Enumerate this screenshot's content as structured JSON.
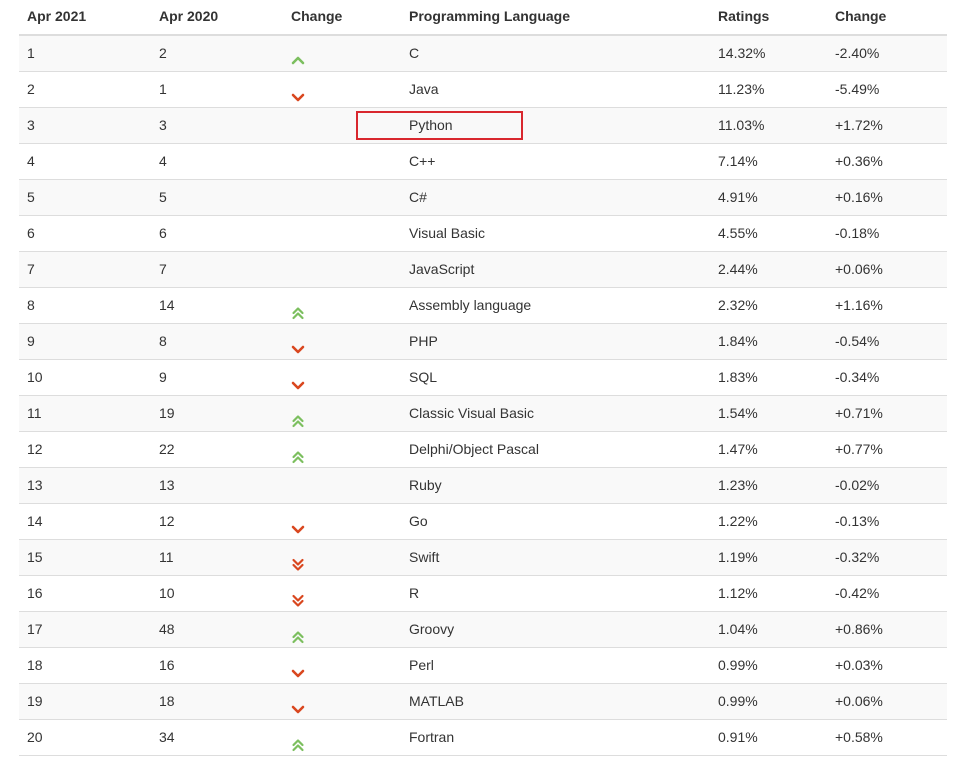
{
  "columns": {
    "rank": "Apr 2021",
    "previous": "Apr 2020",
    "trend": "Change",
    "language": "Programming Language",
    "rating": "Ratings",
    "change": "Change"
  },
  "colors": {
    "up": "#7cbf5f",
    "down": "#d9471f",
    "highlight": "#d9272e"
  },
  "highlighted_language": "Python",
  "rows": [
    {
      "rank": "1",
      "previous": "2",
      "trend": "up",
      "language": "C",
      "rating": "14.32%",
      "change": "-2.40%"
    },
    {
      "rank": "2",
      "previous": "1",
      "trend": "down",
      "language": "Java",
      "rating": "11.23%",
      "change": "-5.49%"
    },
    {
      "rank": "3",
      "previous": "3",
      "trend": "none",
      "language": "Python",
      "rating": "11.03%",
      "change": "+1.72%"
    },
    {
      "rank": "4",
      "previous": "4",
      "trend": "none",
      "language": "C++",
      "rating": "7.14%",
      "change": "+0.36%"
    },
    {
      "rank": "5",
      "previous": "5",
      "trend": "none",
      "language": "C#",
      "rating": "4.91%",
      "change": "+0.16%"
    },
    {
      "rank": "6",
      "previous": "6",
      "trend": "none",
      "language": "Visual Basic",
      "rating": "4.55%",
      "change": "-0.18%"
    },
    {
      "rank": "7",
      "previous": "7",
      "trend": "none",
      "language": "JavaScript",
      "rating": "2.44%",
      "change": "+0.06%"
    },
    {
      "rank": "8",
      "previous": "14",
      "trend": "up-double",
      "language": "Assembly language",
      "rating": "2.32%",
      "change": "+1.16%"
    },
    {
      "rank": "9",
      "previous": "8",
      "trend": "down",
      "language": "PHP",
      "rating": "1.84%",
      "change": "-0.54%"
    },
    {
      "rank": "10",
      "previous": "9",
      "trend": "down",
      "language": "SQL",
      "rating": "1.83%",
      "change": "-0.34%"
    },
    {
      "rank": "11",
      "previous": "19",
      "trend": "up-double",
      "language": "Classic Visual Basic",
      "rating": "1.54%",
      "change": "+0.71%"
    },
    {
      "rank": "12",
      "previous": "22",
      "trend": "up-double",
      "language": "Delphi/Object Pascal",
      "rating": "1.47%",
      "change": "+0.77%"
    },
    {
      "rank": "13",
      "previous": "13",
      "trend": "none",
      "language": "Ruby",
      "rating": "1.23%",
      "change": "-0.02%"
    },
    {
      "rank": "14",
      "previous": "12",
      "trend": "down",
      "language": "Go",
      "rating": "1.22%",
      "change": "-0.13%"
    },
    {
      "rank": "15",
      "previous": "11",
      "trend": "down-double",
      "language": "Swift",
      "rating": "1.19%",
      "change": "-0.32%"
    },
    {
      "rank": "16",
      "previous": "10",
      "trend": "down-double",
      "language": "R",
      "rating": "1.12%",
      "change": "-0.42%"
    },
    {
      "rank": "17",
      "previous": "48",
      "trend": "up-double",
      "language": "Groovy",
      "rating": "1.04%",
      "change": "+0.86%"
    },
    {
      "rank": "18",
      "previous": "16",
      "trend": "down",
      "language": "Perl",
      "rating": "0.99%",
      "change": "+0.03%"
    },
    {
      "rank": "19",
      "previous": "18",
      "trend": "down",
      "language": "MATLAB",
      "rating": "0.99%",
      "change": "+0.06%"
    },
    {
      "rank": "20",
      "previous": "34",
      "trend": "up-double",
      "language": "Fortran",
      "rating": "0.91%",
      "change": "+0.58%"
    }
  ]
}
